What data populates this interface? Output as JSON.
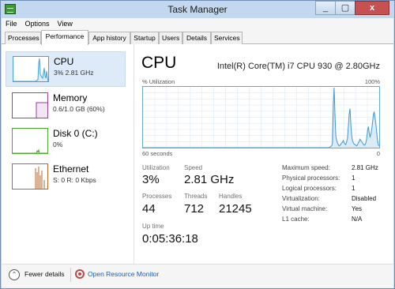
{
  "window": {
    "title": "Task Manager",
    "controls": [
      "_",
      "▢",
      "x"
    ]
  },
  "menu": [
    "File",
    "Options",
    "View"
  ],
  "tabs": [
    "Processes",
    "Performance",
    "App history",
    "Startup",
    "Users",
    "Details",
    "Services"
  ],
  "active_tab": "Performance",
  "sidebar": [
    {
      "name": "CPU",
      "value": "3% 2.81 GHz",
      "color": "#4a9fd8"
    },
    {
      "name": "Memory",
      "value": "0.6/1.0 GB (60%)",
      "color": "#9b3fa3"
    },
    {
      "name": "Disk 0 (C:)",
      "value": "0%",
      "color": "#4caa2a"
    },
    {
      "name": "Ethernet",
      "value": "S: 0 R: 0 Kbps",
      "color": "#b9682b"
    }
  ],
  "main": {
    "title": "CPU",
    "model": "Intel(R) Core(TM) i7 CPU 930 @ 2.80GHz",
    "graph": {
      "top_left": "% Utilization",
      "top_right": "100%",
      "bottom_left": "60 seconds",
      "bottom_right": "0"
    },
    "stats": {
      "utilization": {
        "label": "Utilization",
        "value": "3%"
      },
      "speed": {
        "label": "Speed",
        "value": "2.81 GHz"
      },
      "processes": {
        "label": "Processes",
        "value": "44"
      },
      "threads": {
        "label": "Threads",
        "value": "712"
      },
      "handles": {
        "label": "Handles",
        "value": "21245"
      },
      "uptime": {
        "label": "Up time",
        "value": "0:05:36:18"
      }
    },
    "details": [
      {
        "label": "Maximum speed:",
        "value": "2.81 GHz"
      },
      {
        "label": "Physical processors:",
        "value": "1"
      },
      {
        "label": "Logical processors:",
        "value": "1"
      },
      {
        "label": "Virtualization:",
        "value": "Disabled"
      },
      {
        "label": "Virtual machine:",
        "value": "Yes"
      },
      {
        "label": "L1 cache:",
        "value": "N/A"
      }
    ]
  },
  "bottom": {
    "fewer_details": "Fewer details",
    "open_resource_monitor": "Open Resource Monitor"
  },
  "cpu_history": [
    0,
    0,
    0,
    0,
    0,
    0,
    0,
    0,
    0,
    0,
    0,
    0,
    0,
    0,
    0,
    0,
    0,
    0,
    0,
    0,
    0,
    0,
    0,
    0,
    0,
    0,
    0,
    0,
    0,
    0,
    0,
    0,
    0,
    0,
    0,
    0,
    0,
    0,
    0,
    0,
    0,
    0,
    0,
    0,
    0,
    0,
    0,
    0,
    0,
    0,
    0,
    0,
    0,
    0,
    0,
    0,
    0,
    0,
    0,
    0,
    0,
    0,
    0,
    0,
    0,
    0,
    0,
    0,
    0,
    0,
    0,
    0,
    0,
    0,
    0,
    0,
    0,
    0,
    0,
    0,
    0,
    0,
    0,
    0,
    0,
    0,
    0,
    0,
    0,
    0,
    0,
    0,
    0,
    0,
    0,
    0,
    0,
    0,
    0,
    0,
    0,
    0,
    0,
    0,
    0,
    0,
    0,
    0,
    0,
    0,
    0,
    0,
    0,
    0,
    0,
    0,
    0,
    0,
    0,
    0,
    0,
    0,
    0,
    0,
    0,
    0,
    0,
    0,
    0,
    0,
    0,
    0,
    0,
    0,
    0,
    0,
    0,
    0,
    0,
    0,
    0,
    0,
    0,
    0,
    0,
    0,
    0,
    0,
    0,
    0,
    0,
    0,
    0,
    0,
    0,
    0,
    0,
    0,
    0,
    0,
    0,
    0,
    0,
    0,
    0,
    0,
    0,
    0,
    0,
    0,
    0,
    0,
    0,
    0,
    0,
    0,
    0,
    0,
    0,
    0,
    0,
    0,
    0,
    0,
    0,
    0,
    0,
    0,
    0,
    0,
    0,
    0,
    0,
    0,
    0,
    0,
    0,
    0,
    0,
    0,
    0,
    0,
    0,
    0,
    0,
    0,
    0,
    0,
    0,
    0,
    0,
    0,
    0,
    0,
    0,
    0,
    0,
    0,
    0,
    0,
    0,
    0,
    0,
    0,
    1,
    2,
    3,
    8,
    70,
    100,
    55,
    20,
    12,
    8,
    5,
    3,
    4,
    6,
    8,
    9,
    12,
    8,
    6,
    5,
    10,
    15,
    35,
    55,
    65,
    40,
    20,
    12,
    8,
    6,
    5,
    4,
    3,
    5,
    8,
    10,
    14,
    12,
    10,
    8,
    6,
    4,
    5,
    8,
    15,
    28,
    35,
    25,
    18,
    22,
    30,
    42,
    55,
    60,
    50,
    40,
    25,
    12,
    5,
    3
  ]
}
